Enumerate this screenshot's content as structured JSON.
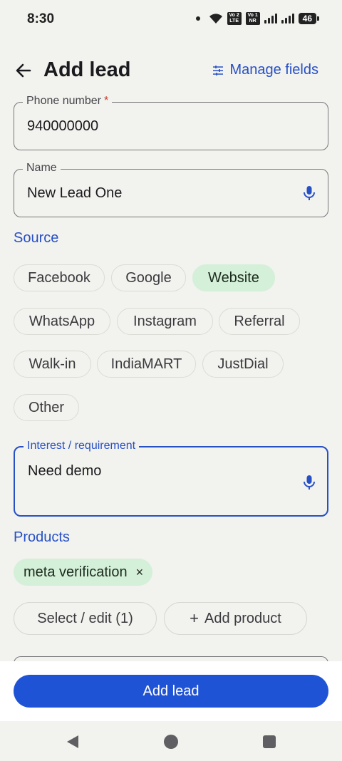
{
  "status_bar": {
    "time": "8:30",
    "sim1": "Vo 2\nLTE",
    "sim2": "Vo 1\nNR",
    "battery": "46"
  },
  "header": {
    "title": "Add lead",
    "manage_fields": "Manage fields",
    "back_icon": "arrow-left-icon",
    "manage_icon": "sliders-icon"
  },
  "phone": {
    "label": "Phone number",
    "required_mark": "*",
    "value": "940000000"
  },
  "name": {
    "label": "Name",
    "value": "New Lead One",
    "mic_icon": "microphone-icon"
  },
  "source": {
    "title": "Source",
    "selected": "Website",
    "options": [
      "Facebook",
      "Google",
      "Website",
      "WhatsApp",
      "Instagram",
      "Referral",
      "Walk-in",
      "IndiaMART",
      "JustDial",
      "Other"
    ]
  },
  "interest": {
    "label": "Interest / requirement",
    "value": "Need demo",
    "mic_icon": "microphone-icon"
  },
  "products": {
    "title": "Products",
    "selected_chip": "meta verification",
    "remove_glyph": "×",
    "select_edit_label": "Select / edit (1)",
    "add_product_label": "Add product",
    "add_glyph": "+"
  },
  "footer": {
    "submit_label": "Add lead"
  },
  "colors": {
    "accent": "#2750c5",
    "primary_button": "#1f53d6",
    "selected_chip": "#d4f0d8",
    "background": "#f2f2ee"
  }
}
